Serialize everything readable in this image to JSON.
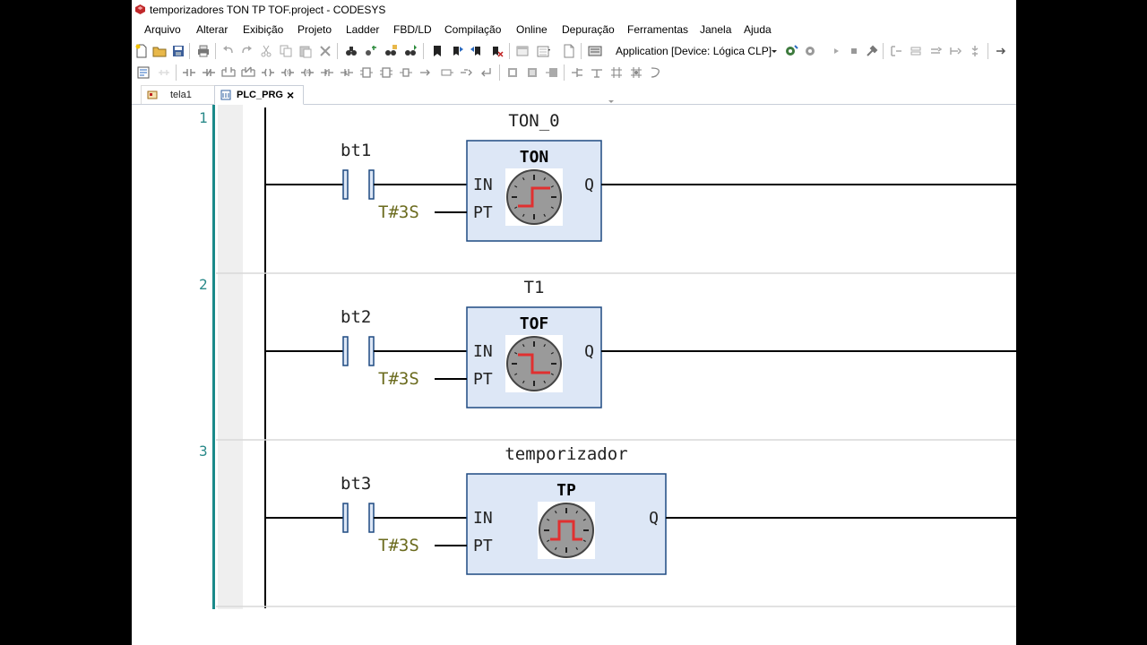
{
  "window": {
    "title": "temporizadores TON TP TOF.project - CODESYS"
  },
  "menu": [
    "Arquivo",
    "Alterar",
    "Exibição",
    "Projeto",
    "Ladder",
    "FBD/LD",
    "Compilação",
    "Online",
    "Depuração",
    "Ferramentas",
    "Janela",
    "Ajuda"
  ],
  "toolbar": {
    "application_select": "Application [Device: Lógica CLP]"
  },
  "tabs": [
    {
      "label": "tela1",
      "active": false
    },
    {
      "label": "PLC_PRG",
      "active": true,
      "close": "×"
    }
  ],
  "colors": {
    "box_fill": "#dde7f6",
    "box_stroke": "#1f4a82",
    "rail": "#1b8a8a",
    "const_text": "#6b6b1e",
    "clock_pulse": "#e03030"
  },
  "rungs": [
    {
      "number": "1",
      "instance": "TON_0",
      "contact": "bt1",
      "block": "TON",
      "in_label": "IN",
      "pt_label": "PT",
      "out_label": "Q",
      "pt_value": "T#3S",
      "clock_icon": "ton-clock-icon"
    },
    {
      "number": "2",
      "instance": "T1",
      "contact": "bt2",
      "block": "TOF",
      "in_label": "IN",
      "pt_label": "PT",
      "out_label": "Q",
      "pt_value": "T#3S",
      "clock_icon": "tof-clock-icon"
    },
    {
      "number": "3",
      "instance": "temporizador",
      "contact": "bt3",
      "block": "TP",
      "in_label": "IN",
      "pt_label": "PT",
      "out_label": "Q",
      "pt_value": "T#3S",
      "clock_icon": "tp-clock-icon"
    }
  ]
}
